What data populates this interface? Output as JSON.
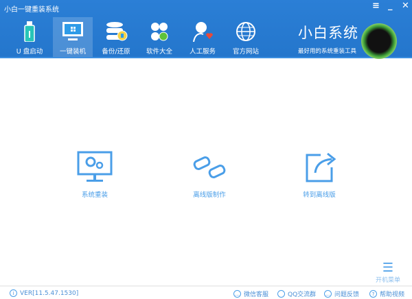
{
  "window": {
    "title": "小白一键重装系统",
    "menu": "≡",
    "minimize": "_",
    "close": "✕"
  },
  "nav": [
    {
      "label": "U 盘启动"
    },
    {
      "label": "一键装机"
    },
    {
      "label": "备份/还原"
    },
    {
      "label": "软件大全"
    },
    {
      "label": "人工服务"
    },
    {
      "label": "官方网站"
    }
  ],
  "brand": {
    "name": "小白系统",
    "slogan": "最好用的系统重装工具"
  },
  "actions": [
    {
      "label": "系统重装"
    },
    {
      "label": "离线版制作"
    },
    {
      "label": "转到离线版"
    }
  ],
  "boot_menu": {
    "label": "开机菜单"
  },
  "footer": {
    "version": "VER[11.5.47.1530]",
    "links": [
      {
        "label": "微信客服"
      },
      {
        "label": "QQ交流群"
      },
      {
        "label": "问题反馈"
      },
      {
        "label": "帮助视频"
      }
    ]
  },
  "colors": {
    "header": "#2b7fd6",
    "accent": "#4a9ee8"
  }
}
